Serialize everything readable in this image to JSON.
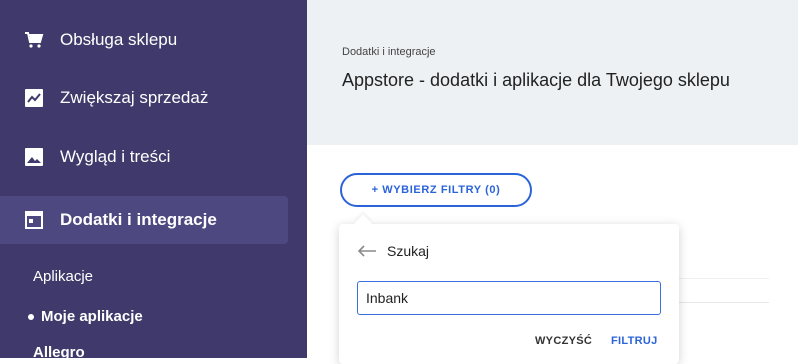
{
  "sidebar": {
    "items": [
      {
        "label": "Obsługa sklepu",
        "icon": "cart-icon"
      },
      {
        "label": "Zwiększaj sprzedaż",
        "icon": "chart-icon"
      },
      {
        "label": "Wygląd i treści",
        "icon": "image-icon"
      },
      {
        "label": "Dodatki i integracje",
        "icon": "window-icon",
        "active": true
      }
    ],
    "subitems": [
      {
        "label": "Aplikacje"
      },
      {
        "label": "Moje aplikacje",
        "selected": true
      },
      {
        "label": "Allegro"
      }
    ]
  },
  "header": {
    "breadcrumb": "Dodatki i integracje",
    "title": "Appstore - dodatki i aplikacje dla Twojego sklepu"
  },
  "filters": {
    "button_label": "+ WYBIERZ FILTRY (0)"
  },
  "search_popup": {
    "label": "Szukaj",
    "input_value": "Inbank",
    "clear_label": "WYCZYŚĆ",
    "apply_label": "FILTRUJ"
  },
  "colors": {
    "sidebar_bg": "#3f3a6b",
    "sidebar_active_bg": "#4d4880",
    "accent": "#2b63d9",
    "header_bg": "#eef1f4"
  }
}
